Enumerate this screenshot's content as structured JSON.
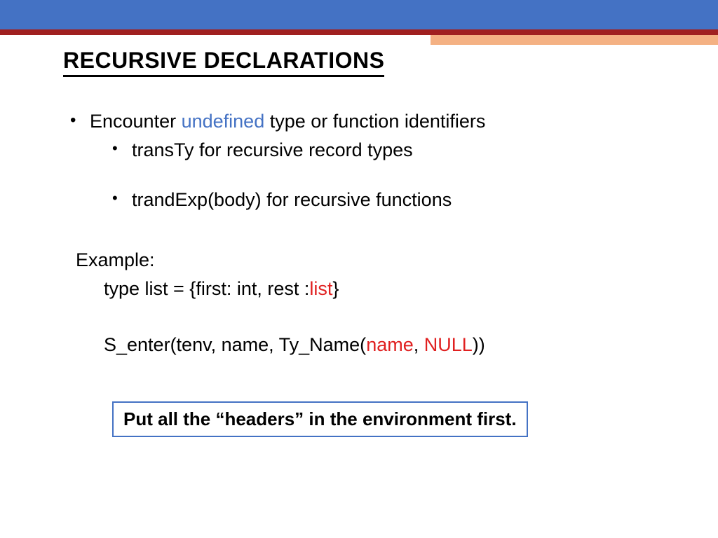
{
  "title": "RECURSIVE DECLARATIONS",
  "bullet1": {
    "prefix": "Encounter ",
    "highlight": "undefined",
    "suffix": " type or function identifiers"
  },
  "sub1": "transTy for recursive record types",
  "sub2": "trandExp(body) for recursive functions",
  "example": {
    "label": "Example:",
    "line2_prefix": "type list = {first: int, rest :",
    "line2_highlight": "list",
    "line2_suffix": "}",
    "line3_prefix": "S_enter(tenv, name, Ty_Name(",
    "line3_hl1": "name",
    "line3_mid": ", ",
    "line3_hl2": "NULL",
    "line3_suffix": "))"
  },
  "callout": "Put all the “headers” in the environment first."
}
